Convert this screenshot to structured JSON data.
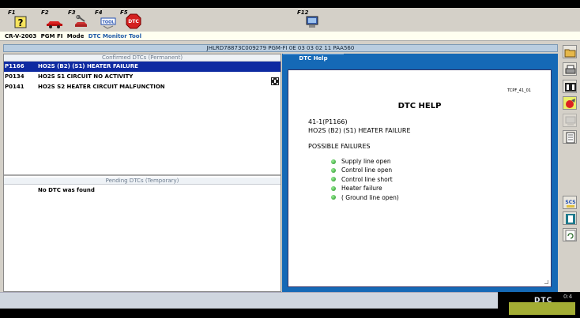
{
  "toolbar": {
    "keys": [
      {
        "label": "F1",
        "icon": "help-icon"
      },
      {
        "label": "F2",
        "icon": "car-icon"
      },
      {
        "label": "F3",
        "icon": "wrench-car-icon"
      },
      {
        "label": "F4",
        "icon": "tool-icon"
      },
      {
        "label": "F5",
        "icon": "dtc-icon"
      },
      {
        "label": "F12",
        "icon": "computer-icon"
      }
    ],
    "f4_text": "TOOL",
    "f5_text": "DTC"
  },
  "status": {
    "vehicle": "CR-V-2003",
    "system": "PGM FI",
    "mode_label": "Mode",
    "mode_value": "DTC Monitor Tool"
  },
  "vin_bar": "JHLRD78873C009279  PGM-FI  0E 03 03 02 11  PAA560",
  "confirmed": {
    "header": "Confirmed DTCs (Permanent)",
    "rows": [
      {
        "code": "P1166",
        "desc": "HO2S (B2) (S1) HEATER FAILURE"
      },
      {
        "code": "P0134",
        "desc": "HO2S S1 CIRCUIT NO ACTIVITY"
      },
      {
        "code": "P0141",
        "desc": "HO2S S2 HEATER CIRCUIT MALFUNCTION"
      }
    ]
  },
  "pending": {
    "header": "Pending DTCs (Temporary)",
    "message": "No DTC was found"
  },
  "help": {
    "tab": "DTC Help",
    "page_code": "TCPF_41_01",
    "title": "DTC HELP",
    "line1": "41-1(P1166)",
    "line2": "HO2S (B2) (S1) HEATER FAILURE",
    "failures_title": "POSSIBLE FAILURES",
    "failures": [
      "Supply line open",
      "Control line open",
      "Control line short",
      "Heater failure",
      "( Ground line open)"
    ]
  },
  "sidebar": {
    "buttons": [
      "open-folder-icon",
      "printer-icon",
      "graph-icon",
      "freeze-frame-icon",
      "dtc-clear-icon",
      "notes-icon",
      "scs-icon",
      "exit-icon",
      "refresh-icon"
    ],
    "scs_text": "SCS"
  },
  "bottom": {
    "badge": "DTC",
    "odometer": "0:4"
  },
  "colors": {
    "selection": "#0e2aa1",
    "help_panel": "#1569b6",
    "active_sidebar": "#eaf06a",
    "bullet": "#1f8f1f"
  }
}
